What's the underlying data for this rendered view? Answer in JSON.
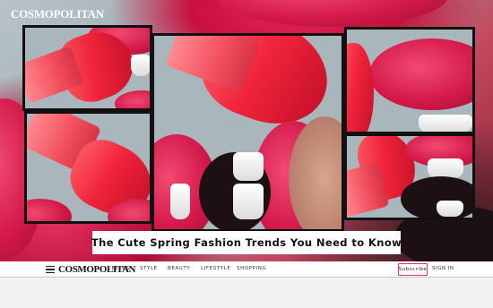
{
  "hero": {
    "brand": "COSMOPOLITAN",
    "headline": "The Cute Spring Fashion Trends You Need to Know"
  },
  "nav": {
    "logo": "COSMOPOLITAN",
    "links": [
      "CELEBS",
      "STYLE",
      "BEAUTY",
      "LIFESTYLE",
      "SHOPPING"
    ],
    "subscribe": "Subscribe",
    "sign_in": "SIGN IN"
  },
  "colors": {
    "accent": "#e8315e",
    "lipstick": "#f0243a",
    "lip": "#d4194a"
  },
  "icons": [
    "menu-icon"
  ]
}
